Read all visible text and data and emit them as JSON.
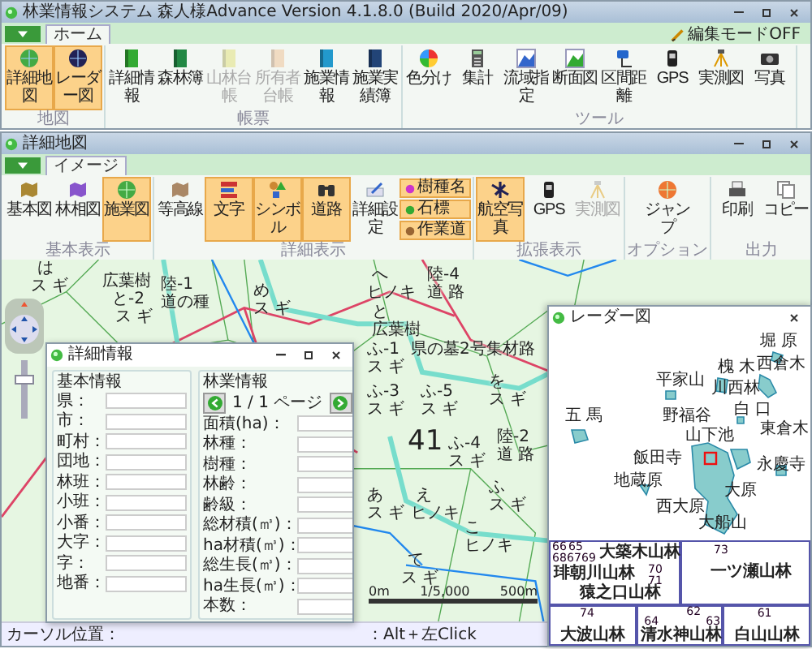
{
  "main_window": {
    "title": "林業情報システム 森人様Advance Version 4.1.8.0 (Build 2020/Apr/09)",
    "tabs": [
      {
        "label": "ホーム",
        "selected": true
      }
    ],
    "edit_mode": "編集モードOFF",
    "groups": [
      {
        "label": "地図",
        "buttons": [
          {
            "label": "詳細地図",
            "selected": true,
            "disabled": false
          },
          {
            "label": "レーダー図",
            "selected": true,
            "disabled": false
          }
        ]
      },
      {
        "label": "帳票",
        "buttons": [
          {
            "label": "詳細情報",
            "selected": false,
            "disabled": false
          },
          {
            "label": "森林簿",
            "selected": false,
            "disabled": false
          },
          {
            "label": "山林台帳",
            "selected": false,
            "disabled": true
          },
          {
            "label": "所有者台帳",
            "selected": false,
            "disabled": true
          },
          {
            "label": "施業情報",
            "selected": false,
            "disabled": false
          },
          {
            "label": "施業実績簿",
            "selected": false,
            "disabled": false
          }
        ]
      },
      {
        "label": "ツール",
        "buttons": [
          {
            "label": "色分け",
            "selected": false,
            "disabled": false
          },
          {
            "label": "集計",
            "selected": false,
            "disabled": false
          },
          {
            "label": "流域指定",
            "selected": false,
            "disabled": false
          },
          {
            "label": "断面図",
            "selected": false,
            "disabled": false
          },
          {
            "label": "区間距離",
            "selected": false,
            "disabled": false
          },
          {
            "label": "GPS",
            "selected": false,
            "disabled": false
          },
          {
            "label": "実測図",
            "selected": false,
            "disabled": false
          },
          {
            "label": "写真",
            "selected": false,
            "disabled": false
          }
        ]
      }
    ]
  },
  "map_window": {
    "title": "詳細地図",
    "tabs": [
      {
        "label": "イメージ",
        "selected": true
      }
    ],
    "groups": [
      {
        "label": "基本表示",
        "buttons": [
          {
            "kind": "large",
            "label": "基本図",
            "selected": false,
            "disabled": false
          },
          {
            "kind": "large",
            "label": "林相図",
            "selected": false,
            "disabled": false
          },
          {
            "kind": "large",
            "label": "施業図",
            "selected": true,
            "disabled": false
          }
        ]
      },
      {
        "label": "詳細表示",
        "buttons": [
          {
            "kind": "large",
            "label": "等高線",
            "selected": false,
            "disabled": false
          },
          {
            "kind": "large",
            "label": "文字",
            "selected": true,
            "disabled": false
          },
          {
            "kind": "large",
            "label": "シンボル",
            "selected": true,
            "disabled": false
          },
          {
            "kind": "large",
            "label": "道路",
            "selected": true,
            "disabled": false
          },
          {
            "kind": "large",
            "label": "詳細設定",
            "selected": false,
            "disabled": false
          },
          {
            "kind": "small",
            "label": "樹種名",
            "selected": true,
            "disabled": false
          },
          {
            "kind": "small",
            "label": "石標",
            "selected": true,
            "disabled": false
          },
          {
            "kind": "small",
            "label": "作業道",
            "selected": true,
            "disabled": false
          }
        ]
      },
      {
        "label": "拡張表示",
        "buttons": [
          {
            "kind": "large",
            "label": "航空写真",
            "selected": true,
            "disabled": false
          },
          {
            "kind": "large",
            "label": "GPS",
            "selected": false,
            "disabled": false
          },
          {
            "kind": "large",
            "label": "実測図",
            "selected": false,
            "disabled": true
          }
        ]
      },
      {
        "label": "オプション",
        "buttons": [
          {
            "kind": "large",
            "label": "ジャンプ",
            "selected": false,
            "disabled": false
          }
        ]
      },
      {
        "label": "出力",
        "buttons": [
          {
            "kind": "large",
            "label": "印刷",
            "selected": false,
            "disabled": false
          },
          {
            "kind": "large",
            "label": "コピー",
            "selected": false,
            "disabled": false
          }
        ]
      }
    ],
    "map": {
      "zoom_slider": {
        "level": 0.7
      },
      "parcel_number": "41",
      "labels": [
        "は",
        "ス ギ",
        "広葉樹",
        "と-2",
        "ス ギ",
        "陸-1",
        "道の種",
        "め",
        "ス ギ",
        "へ",
        "ヒノキ",
        "陸-4",
        "道 路",
        "と",
        "広葉樹",
        "ふ-1",
        "ス ギ",
        "県の墓2号集材路",
        "ふ-3",
        "ス ギ",
        "ふ-5",
        "ス ギ",
        "を",
        "ス ギ",
        "ふ-4",
        "ス ギ",
        "陸-2",
        "道 路",
        "ふ",
        "ス ギ",
        "あ",
        "ス ギ",
        "え",
        "ヒノキ",
        "こ",
        "ヒノキ",
        "て",
        "ス ギ"
      ],
      "scale": {
        "start": "0m",
        "ratio": "1/5,000",
        "end": "500m"
      }
    },
    "status_bar": {
      "cursor_label": "カーソル位置：",
      "hint": "：Alt＋左Click"
    }
  },
  "detail_dialog": {
    "title": "詳細情報",
    "basic": {
      "title": "基本情報",
      "fields": [
        "県：",
        "市：",
        "町村：",
        "団地：",
        "林班：",
        "小班：",
        "小番：",
        "大字：",
        "字：",
        "地番："
      ]
    },
    "forest": {
      "title": "林業情報",
      "page": "1 / 1 ページ",
      "fields": [
        "面積(ha)：",
        "林種：",
        "樹種：",
        "林齢：",
        "齢級：",
        "総材積(㎥)：",
        "ha材積(㎥)：",
        "総生長(㎥)：",
        "ha生長(㎥)：",
        "本数："
      ]
    }
  },
  "radar_window": {
    "title": "レーダー図",
    "labels": [
      "堀 原",
      "槐 木",
      "平家山",
      "西倉木",
      "川西林",
      "白 口",
      "東倉木",
      "五 馬",
      "野福谷",
      "山下池",
      "飯田寺",
      "地蔵原",
      "永慶寺",
      "西大原",
      "大原",
      "大船山"
    ],
    "panels": [
      {
        "names": [
          "大築木山林",
          "琲朝川山林",
          "猿之口山林"
        ],
        "numbers": [
          "66",
          "65",
          "68",
          "67",
          "69",
          "70",
          "71"
        ]
      },
      {
        "names": [
          "一ツ瀬山林"
        ],
        "numbers": [
          "73"
        ]
      },
      {
        "names": [
          "大波山林"
        ],
        "numbers": [
          "74"
        ]
      },
      {
        "names": [
          "清水神山林"
        ],
        "numbers": [
          "62",
          "64",
          "63"
        ]
      },
      {
        "names": [
          "白山山林"
        ],
        "numbers": [
          "61"
        ]
      }
    ]
  }
}
